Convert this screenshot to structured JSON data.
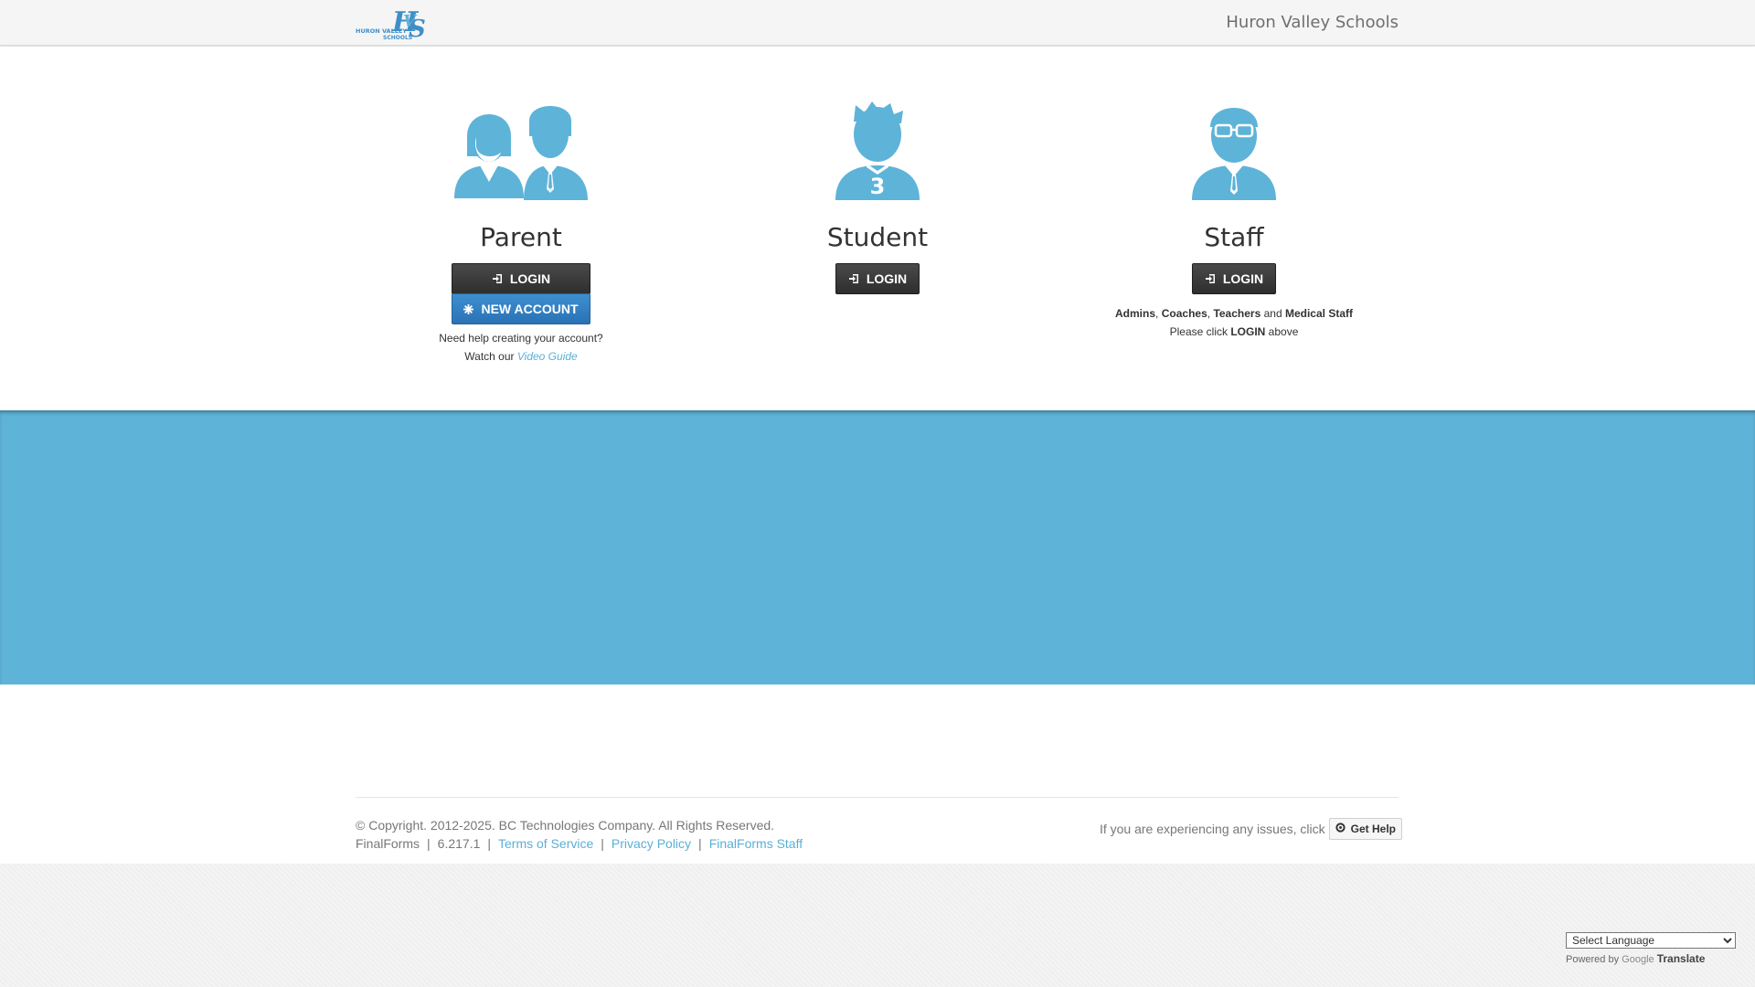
{
  "header": {
    "logo_text": "HVS",
    "logo_subtext": "HURON VALLEY SCHOOLS",
    "district_name": "Huron Valley Schools"
  },
  "roles": {
    "parent": {
      "title": "Parent",
      "login_label": "LOGIN",
      "new_account_label": "NEW ACCOUNT",
      "help_line1": "Need help creating your account?",
      "help_line2_prefix": "Watch our",
      "video_guide_link": "Video Guide"
    },
    "student": {
      "title": "Student",
      "login_label": "LOGIN",
      "jersey_number": "3"
    },
    "staff": {
      "title": "Staff",
      "login_label": "LOGIN",
      "note_admins": "Admins",
      "note_comma1": ",",
      "note_coaches": "Coaches",
      "note_comma2": ",",
      "note_teachers": "Teachers",
      "note_and": "and",
      "note_medical": "Medical Staff",
      "note_line2_prefix": "Please click",
      "note_line2_login": "LOGIN",
      "note_line2_suffix": "above"
    }
  },
  "footer": {
    "copyright": "© Copyright. 2012-2025. BC Technologies Company. All Rights Reserved.",
    "product": "FinalForms",
    "version": "6.217.1",
    "sep": "|",
    "terms_link": "Terms of Service",
    "privacy_link": "Privacy Policy",
    "staff_link": "FinalForms Staff",
    "issues_text": "If you are experiencing any issues, click",
    "get_help_label": "Get Help"
  },
  "translate": {
    "select_language": "Select Language",
    "powered_by": "Powered by",
    "google": "Google",
    "translate_word": "Translate"
  },
  "colors": {
    "accent_blue": "#5eb3d8",
    "icon_blue": "#5eb3d8",
    "button_dark": "#333333",
    "button_blue": "#2f7bbf",
    "link_blue": "#5bafd6"
  },
  "icons": {
    "login": "sign-in-icon",
    "new_account": "asterisk-icon",
    "get_help": "lifebuoy-icon"
  }
}
